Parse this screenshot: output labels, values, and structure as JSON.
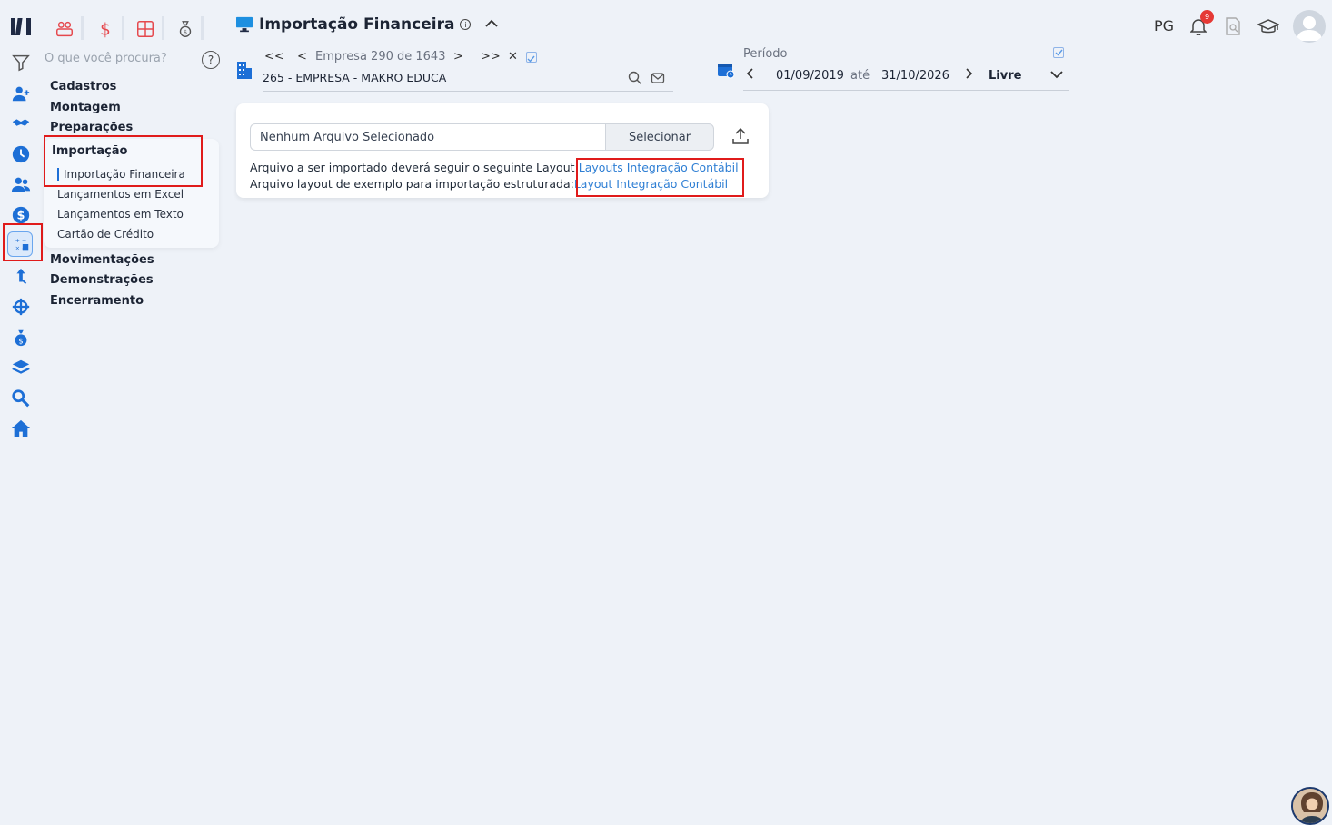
{
  "header": {
    "title": "Importação Financeira",
    "initials": "PG",
    "notifications_count": "9"
  },
  "search": {
    "placeholder": "O que você procura?"
  },
  "menu": {
    "sections": [
      "Cadastros",
      "Montagem",
      "Preparações"
    ],
    "open_section": "Importação",
    "sub_items": [
      "Importação Financeira",
      "Lançamentos em Excel",
      "Lançamentos em Texto",
      "Cartão de Crédito"
    ],
    "active_sub_item": "Importação Financeira",
    "sections_after": [
      "Movimentações",
      "Demonstrações",
      "Encerramento"
    ]
  },
  "empresa": {
    "nav_text": "Empresa 290 de 1643",
    "first": "<<",
    "prev": "<",
    "next": ">",
    "last": ">>",
    "clear": "✕",
    "selected": "265 - EMPRESA - MAKRO EDUCA"
  },
  "periodo": {
    "label": "Período",
    "start": "01/09/2019",
    "separator": "até",
    "end": "31/10/2026",
    "mode": "Livre"
  },
  "import_card": {
    "file_value": "Nenhum Arquivo Selecionado",
    "select_label": "Selecionar",
    "line1_text": "Arquivo a ser importado deverá seguir o seguinte Layout:",
    "line1_link": "Layouts Integração Contábil",
    "line2_text": "Arquivo layout de exemplo para importação estruturada:",
    "line2_link": "Layout Integração Contábil"
  },
  "colors": {
    "accent": "#1d6fd6",
    "link": "#2f7fd4",
    "highlight": "#e01b1b",
    "fav_red": "#e5484d"
  }
}
